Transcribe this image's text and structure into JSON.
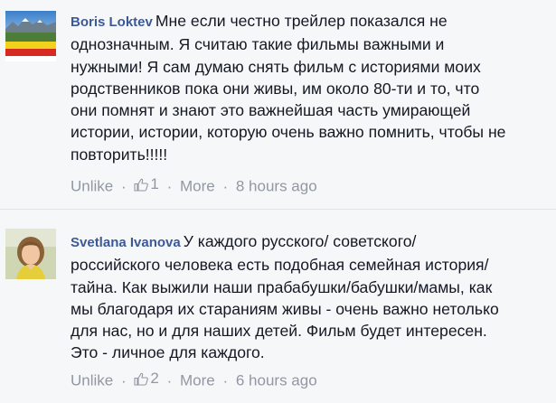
{
  "comments": [
    {
      "author": "Boris Loktev",
      "text": "Мне если честно трейлер показался не\nоднозначным. Я считаю такие фильмы важными и\nнужными! Я сам думаю снять фильм с историями моих\nродственников пока они живы, им около 80-ти и то, что\nони помнят и знают это важнейшая часть умирающей\nистории, истории, которую очень важно помнить, чтобы не\nповторить!!!!!",
      "unlike_label": "Unlike",
      "like_count": "1",
      "more_label": "More",
      "time": "8 hours ago",
      "separator": "·"
    },
    {
      "author": "Svetlana Ivanova",
      "text": "У каждого русского/ советского/\nроссийского человека есть подобная семейная история/\nтайна. Как выжили наши прабабушки/бабушки/мамы, как\nмы благодаря их стараниям живы - очень важно нетолько\nдля нас, но и для наших детей. Фильм будет интересен.\nЭто - личное для каждого.",
      "unlike_label": "Unlike",
      "like_count": "2",
      "more_label": "More",
      "time": "6 hours ago",
      "separator": "·"
    }
  ],
  "colors": {
    "author": "#3b5998",
    "body_text": "#141823",
    "meta_text": "#9197a3",
    "background": "#f6f7f9"
  },
  "icons": {
    "like": "thumbs-up-icon"
  }
}
